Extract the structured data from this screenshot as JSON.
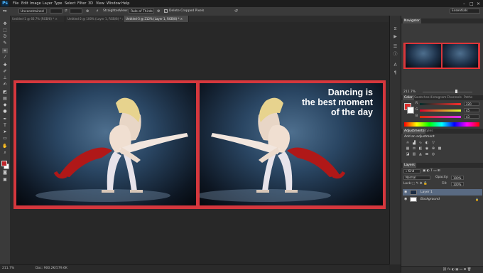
{
  "app": {
    "logo": "Ps"
  },
  "menubar": {
    "items": [
      "File",
      "Edit",
      "Image",
      "Layer",
      "Type",
      "Select",
      "Filter",
      "3D",
      "View",
      "Window",
      "Help"
    ]
  },
  "window_controls": {
    "minimize": "–",
    "maximize": "□",
    "close": "×"
  },
  "options_bar": {
    "style_value": "Unconstrained",
    "swap_symbol": "⇄",
    "straighten_label": "Straighten",
    "view_label": "View:",
    "view_value": "Rule of Thirds",
    "delete_cropped_label": "Delete Cropped Pixels",
    "workspace": "Essentials"
  },
  "doc_tabs": [
    {
      "label": "Untitled-1 @ 66.7% (RGB/8) *",
      "close": "×"
    },
    {
      "label": "Untitled-2 @ 100% (Layer 1, RGB/8) *",
      "close": "×"
    },
    {
      "label": "Untitled-3 @ 212% (Layer 1, RGB/8) *",
      "close": "×"
    }
  ],
  "artwork": {
    "tagline_lines": [
      "Dancing is",
      "the best moment",
      "of the day"
    ],
    "frame_color": "#d5373d"
  },
  "status": {
    "zoom": "211.7%",
    "doc_info": "Doc: 900.2K/579.6K"
  },
  "navigator": {
    "tab": "Navigator",
    "zoom": "211.7%"
  },
  "color_panel": {
    "tabs": [
      "Color",
      "Swatches",
      "Histogram",
      "Channels",
      "Paths"
    ],
    "r_label": "R",
    "r_value": "220",
    "g_label": "G",
    "g_value": "45",
    "b_label": "B",
    "b_value": "43",
    "foreground_color": "#dc2d2b"
  },
  "adjustments_panel": {
    "tabs": [
      "Adjustments",
      "Styles"
    ],
    "heading": "Add an adjustment"
  },
  "layers_panel": {
    "tab": "Layers",
    "kind_filter": "Kind",
    "blend_mode": "Normal",
    "opacity_label": "Opacity:",
    "opacity_value": "100%",
    "lock_label": "Lock:",
    "fill_label": "Fill:",
    "fill_value": "100%",
    "layers": [
      {
        "name": "Layer 1",
        "selected": true
      },
      {
        "name": "Background",
        "selected": false,
        "locked": true
      }
    ]
  }
}
